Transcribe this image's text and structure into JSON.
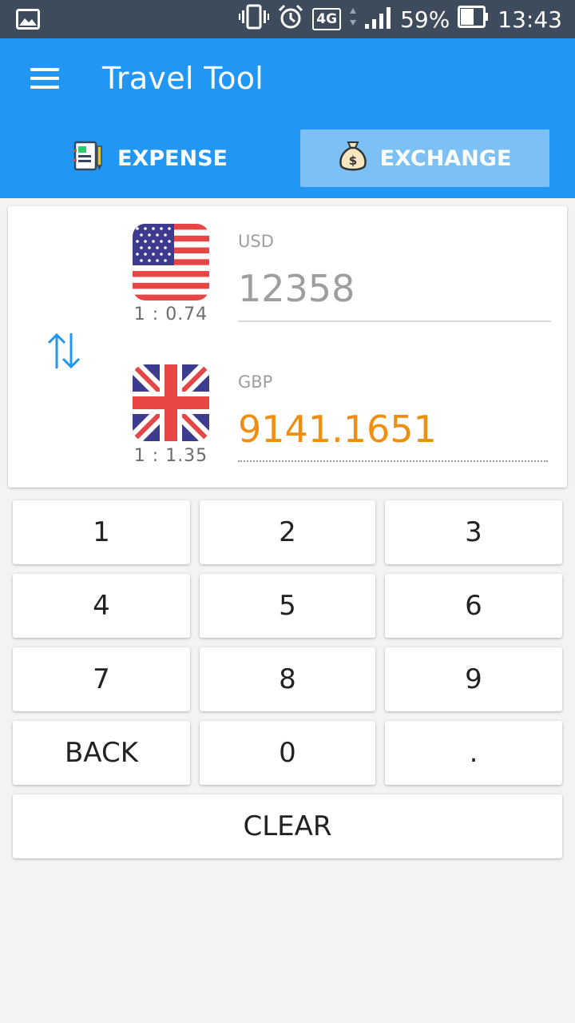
{
  "status_bar": {
    "battery": "59%",
    "time": "13:43",
    "network": "4G",
    "icons": [
      "image-icon",
      "vibrate-icon",
      "alarm-icon",
      "4g-icon",
      "signal-icon",
      "battery-icon"
    ]
  },
  "app_bar": {
    "title": "Travel Tool",
    "menu_icon": "hamburger-menu-icon",
    "color": "#2196f3"
  },
  "tabs": [
    {
      "label": "EXPENSE",
      "icon": "notebook-icon",
      "selected": false
    },
    {
      "label": "EXCHANGE",
      "icon": "money-bag-icon",
      "selected": true
    }
  ],
  "converter": {
    "swap_icon": "swap-arrows-icon",
    "from": {
      "currency": "USD",
      "amount": "12358",
      "rate": "1 : 0.74",
      "flag": "us-flag-icon"
    },
    "to": {
      "currency": "GBP",
      "amount": "9141.1651",
      "rate": "1 : 1.35",
      "flag": "uk-flag-icon",
      "color": "#ef8f12"
    }
  },
  "keypad": {
    "k1": "1",
    "k2": "2",
    "k3": "3",
    "k4": "4",
    "k5": "5",
    "k6": "6",
    "k7": "7",
    "k8": "8",
    "k9": "9",
    "back": "BACK",
    "k0": "0",
    "dot": ".",
    "clear": "CLEAR"
  }
}
